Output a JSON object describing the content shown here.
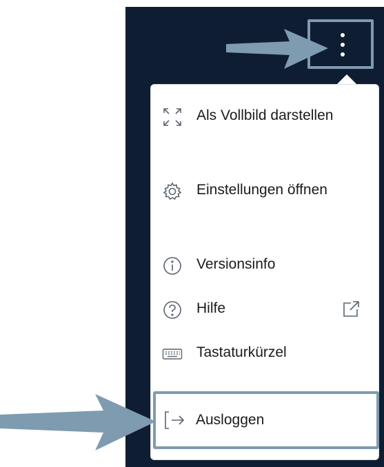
{
  "colors": {
    "panel_background": "#0f1d33",
    "highlight_frame": "#7e9bb0",
    "menu_background": "#ffffff",
    "menu_text": "#1b1b1b",
    "icon_color": "#5a6470"
  },
  "header": {
    "menu_button_icon": "kebab-vertical-icon"
  },
  "menu": {
    "items": [
      {
        "label": "Als Vollbild darstellen",
        "icon": "fullscreen-icon"
      },
      {
        "label": "Einstellungen öffnen",
        "icon": "gear-icon"
      },
      {
        "label": "Versionsinfo",
        "icon": "info-icon"
      },
      {
        "label": "Hilfe",
        "icon": "help-icon",
        "trailing_icon": "external-link-icon"
      },
      {
        "label": "Tastaturkürzel",
        "icon": "keyboard-icon"
      }
    ],
    "logout": {
      "label": "Ausloggen",
      "icon": "logout-icon"
    }
  },
  "annotations": {
    "arrows": [
      "arrow-right-icon",
      "arrow-right-icon"
    ]
  }
}
